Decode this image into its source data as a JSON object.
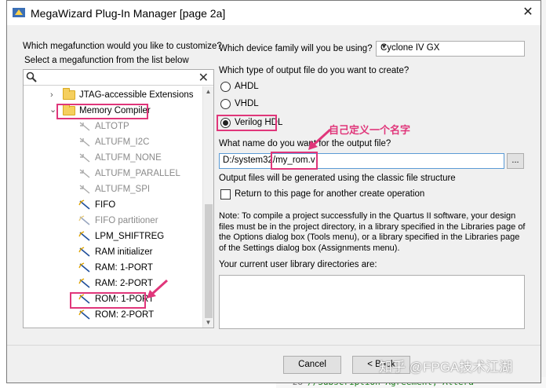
{
  "window": {
    "title": "MegaWizard Plug-In Manager [page 2a]",
    "close_glyph": "✕"
  },
  "left": {
    "question": "Which megafunction would you like to customize?",
    "instruction": "Select a megafunction from the list below",
    "search_placeholder": "",
    "tree": [
      {
        "label": "JTAG-accessible Extensions",
        "kind": "folder",
        "expanded": false
      },
      {
        "label": "Memory Compiler",
        "kind": "folder",
        "expanded": true
      },
      {
        "label": "ALTOTP",
        "kind": "item",
        "enabled": false
      },
      {
        "label": "ALTUFM_I2C",
        "kind": "item",
        "enabled": false
      },
      {
        "label": "ALTUFM_NONE",
        "kind": "item",
        "enabled": false
      },
      {
        "label": "ALTUFM_PARALLEL",
        "kind": "item",
        "enabled": false
      },
      {
        "label": "ALTUFM_SPI",
        "kind": "item",
        "enabled": false
      },
      {
        "label": "FIFO",
        "kind": "item",
        "enabled": true
      },
      {
        "label": "FIFO partitioner",
        "kind": "item",
        "enabled": false
      },
      {
        "label": "LPM_SHIFTREG",
        "kind": "item",
        "enabled": true
      },
      {
        "label": "RAM initializer",
        "kind": "item",
        "enabled": true
      },
      {
        "label": "RAM: 1-PORT",
        "kind": "item",
        "enabled": true
      },
      {
        "label": "RAM: 2-PORT",
        "kind": "item",
        "enabled": true
      },
      {
        "label": "ROM: 1-PORT",
        "kind": "item",
        "enabled": true,
        "selected": true
      },
      {
        "label": "ROM: 2-PORT",
        "kind": "item",
        "enabled": true
      }
    ]
  },
  "right": {
    "device_label": "Which device family will you be using?",
    "device_value": "Cyclone IV GX",
    "output_type_label": "Which type of output file do you want to create?",
    "output_types": [
      {
        "label": "AHDL",
        "checked": false
      },
      {
        "label": "VHDL",
        "checked": false
      },
      {
        "label": "Verilog HDL",
        "checked": true
      }
    ],
    "name_label": "What name do you want for the output file?",
    "name_value": "D:/system32/my_rom.v",
    "browse_label": "...",
    "classic_note": "Output files will be generated using the classic file structure",
    "return_checkbox_label": "Return to this page for another create operation",
    "return_checked": false,
    "note_lines": [
      "Note: To compile a project successfully in the Quartus II software, your design",
      "files must be in the project directory, in a library specified in the Libraries page of",
      "the Options dialog box (Tools menu), or a library specified in the Libraries page",
      "of the Settings dialog box (Assignments menu)."
    ],
    "library_label": "Your current user library directories are:"
  },
  "buttons": {
    "cancel": "Cancel",
    "back": "< Back"
  },
  "annotation": {
    "text": "自己定义一个名字",
    "color": "#e0367a"
  },
  "watermark": "知乎 @FPGA技术江湖",
  "background": {
    "line_number": "28",
    "code_text": "//Subscription Agreement, Altera"
  },
  "colors": {
    "highlight": "#e0367a",
    "dialog_bg": "#f0f0f0",
    "focus_border": "#5b9bd5"
  }
}
